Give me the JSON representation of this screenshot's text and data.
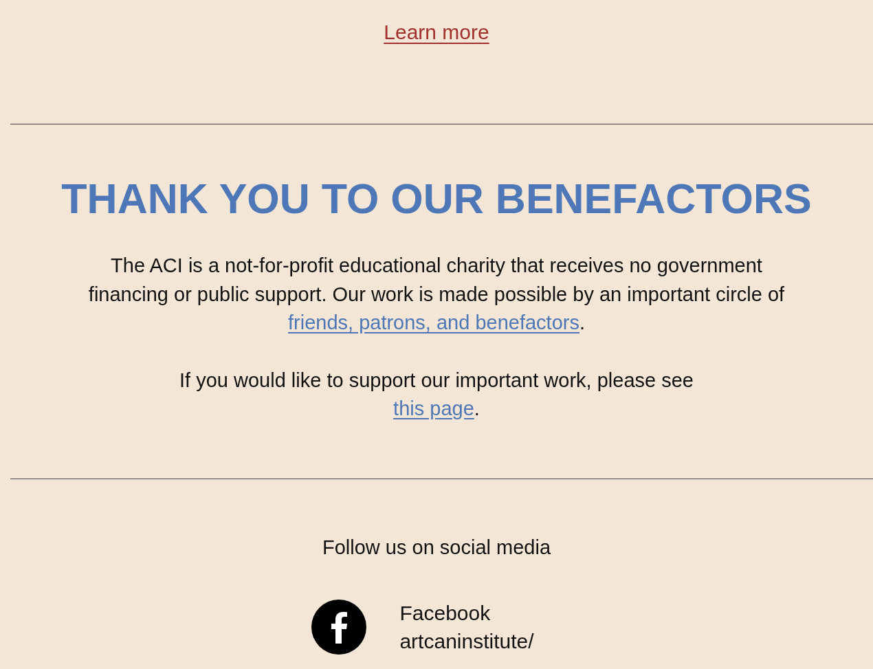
{
  "learn_more": {
    "label": "Learn more"
  },
  "benefactors": {
    "heading": "THANK YOU TO OUR BENEFACTORS",
    "paragraphs": [
      {
        "before": "The ACI is a not-for-profit educational charity that receives no government financing or public support. Our work is made possible by an important circle of ",
        "link": "friends, patrons, and benefactors",
        "after": "."
      },
      {
        "before": "If you would like to support our important work, please see ",
        "link": "this page",
        "after": "."
      }
    ]
  },
  "social": {
    "heading": "Follow us on social media",
    "links": [
      {
        "kind": "facebook",
        "name": "Facebook",
        "handle": "artcaninstitute/"
      }
    ]
  }
}
